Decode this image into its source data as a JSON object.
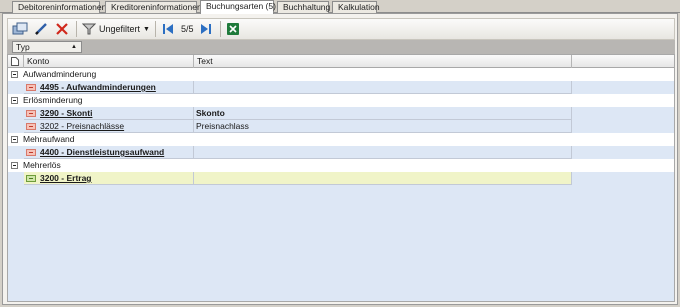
{
  "tabs": [
    {
      "label": "Debitoreninformationen"
    },
    {
      "label": "Kreditoreninformationen"
    },
    {
      "label": "Buchungsarten (5)"
    },
    {
      "label": "Buchhaltung"
    },
    {
      "label": "Kalkulation"
    }
  ],
  "toolbar": {
    "filter_label": "Ungefiltert",
    "pager_text": "5/5"
  },
  "groupby": {
    "field_label": "Typ"
  },
  "grid": {
    "columns": {
      "konto": "Konto",
      "text": "Text"
    },
    "groups": [
      {
        "label": "Aufwandminderung",
        "rows": [
          {
            "konto": "4495 - Aufwandminderungen",
            "text": "",
            "bold": true
          }
        ]
      },
      {
        "label": "Erlösminderung",
        "rows": [
          {
            "konto": "3290 - Skonti",
            "text": "Skonto",
            "bold": true
          },
          {
            "konto": "3202 - Preisnachlässe",
            "text": "Preisnachlass",
            "bold": false
          }
        ]
      },
      {
        "label": "Mehraufwand",
        "rows": [
          {
            "konto": "4400 - Dienstleistungsaufwand",
            "text": "",
            "bold": true
          }
        ]
      },
      {
        "label": "Mehrerlös",
        "rows": [
          {
            "konto": "3200 - Ertrag",
            "text": "",
            "bold": true,
            "selected": true
          }
        ]
      }
    ]
  }
}
